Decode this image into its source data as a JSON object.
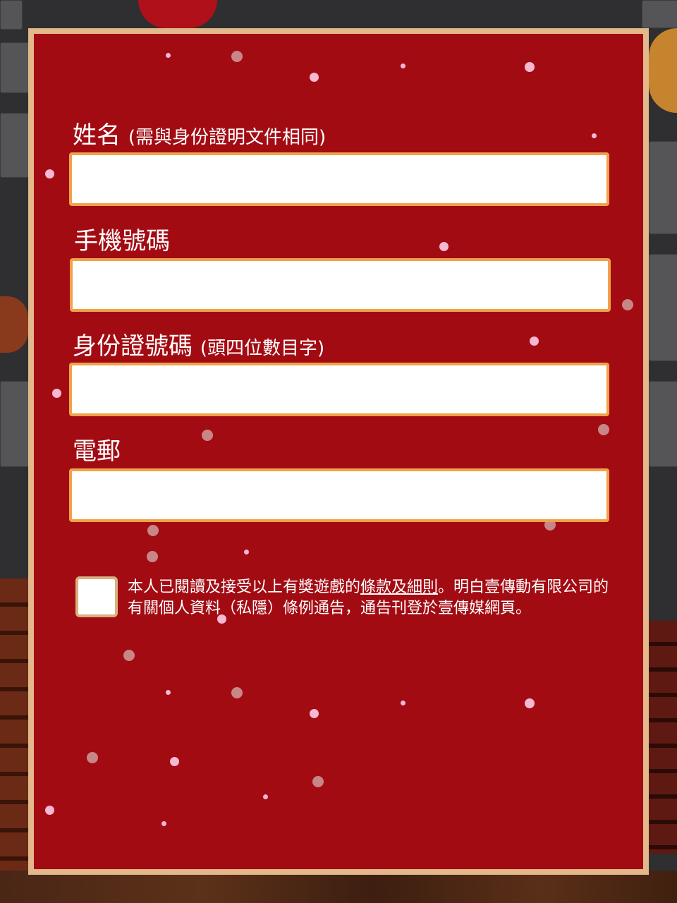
{
  "form": {
    "name": {
      "label": "姓名",
      "hint": "(需與身份證明文件相同)",
      "value": ""
    },
    "mobile": {
      "label": "手機號碼",
      "value": ""
    },
    "id_number": {
      "label": "身份證號碼",
      "hint": "(頭四位數目字)",
      "value": ""
    },
    "email": {
      "label": "電郵",
      "value": ""
    }
  },
  "consent": {
    "checked": false,
    "text_before": "本人已閱讀及接受以上有獎遊戲的",
    "terms_link": "條款及細則",
    "text_after": "。明白壹傳動有限公司的有關個人資料（私隱）條例通告，通告刊登於壹傳媒網頁。"
  },
  "colors": {
    "panel_background": "#a30b13",
    "panel_border": "#e3b88a",
    "input_border": "#f0a24a",
    "snow_pink": "#f7b8d4",
    "snow_grey": "#c98686"
  }
}
